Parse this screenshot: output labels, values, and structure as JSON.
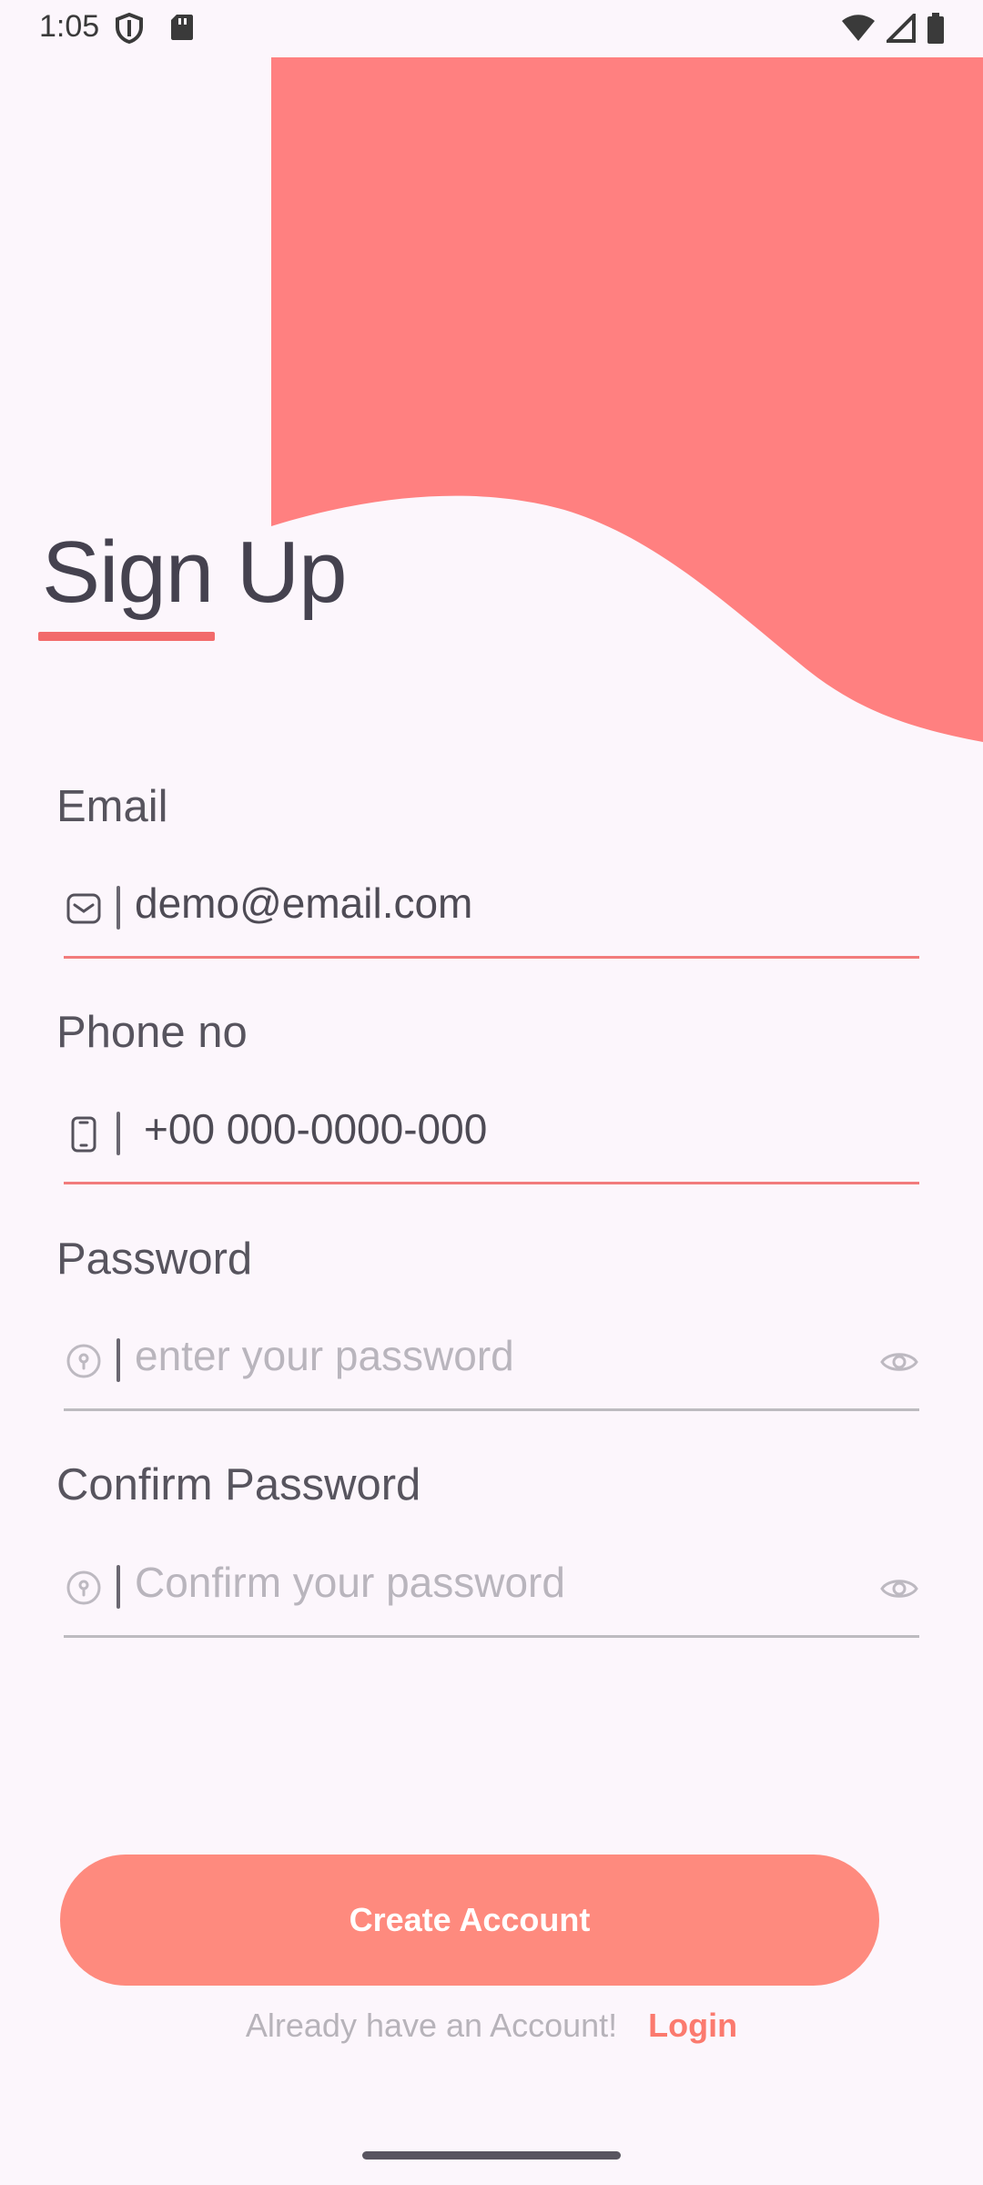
{
  "status_bar": {
    "time": "1:05",
    "icons": [
      "shield-icon",
      "sd-card-icon",
      "wifi-icon",
      "signal-icon",
      "battery-icon"
    ]
  },
  "header": {
    "title": "Sign Up"
  },
  "form": {
    "email": {
      "label": "Email",
      "value": "demo@email.com",
      "icon": "mail-icon"
    },
    "phone": {
      "label": "Phone no",
      "value": "+00 000-0000-000",
      "icon": "phone-icon"
    },
    "password": {
      "label": "Password",
      "placeholder": "enter your password",
      "icon": "key-icon",
      "toggle_icon": "eye-icon"
    },
    "confirm_password": {
      "label": "Confirm Password",
      "placeholder": "Confirm your password",
      "icon": "key-icon",
      "toggle_icon": "eye-icon"
    }
  },
  "actions": {
    "create_account_label": "Create Account",
    "already_text": "Already have an Account!",
    "login_label": "Login"
  },
  "colors": {
    "accent": "#ff8080",
    "button": "#fe8a7e",
    "background": "#fcf6fc"
  }
}
